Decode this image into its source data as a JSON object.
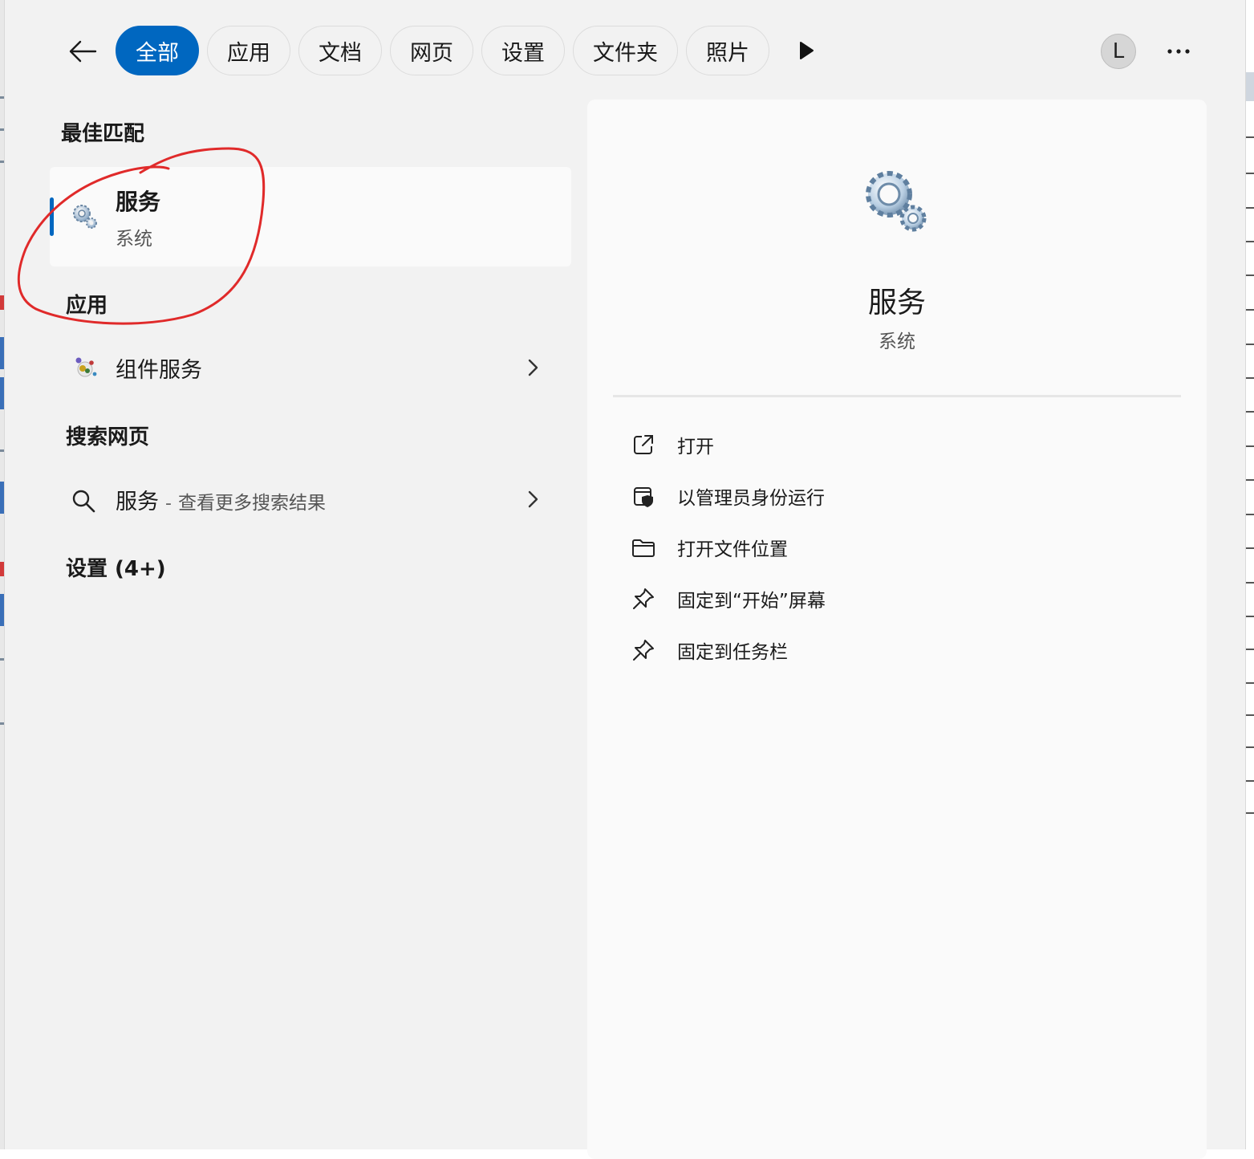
{
  "nav": {
    "tabs": [
      "全部",
      "应用",
      "文档",
      "网页",
      "设置",
      "文件夹",
      "照片"
    ],
    "active_tab": 0,
    "avatar_letter": "L"
  },
  "best_match": {
    "title": "最佳匹配",
    "name": "服务",
    "subtitle": "系统"
  },
  "apps": {
    "title": "应用",
    "items": [
      {
        "label": "组件服务"
      }
    ]
  },
  "web": {
    "title": "搜索网页",
    "query": "服务",
    "separator": "-",
    "hint": "查看更多搜索结果"
  },
  "settings": {
    "title": "设置 (4+)"
  },
  "details": {
    "name": "服务",
    "subtitle": "系统",
    "actions": [
      {
        "label": "打开",
        "icon": "open-external-icon"
      },
      {
        "label": "以管理员身份运行",
        "icon": "shield-icon"
      },
      {
        "label": "打开文件位置",
        "icon": "folder-icon"
      },
      {
        "label": "固定到“开始”屏幕",
        "icon": "pin-icon"
      },
      {
        "label": "固定到任务栏",
        "icon": "pin-icon"
      }
    ]
  },
  "colors": {
    "accent": "#0067c0",
    "annotation": "#e02a2a"
  }
}
